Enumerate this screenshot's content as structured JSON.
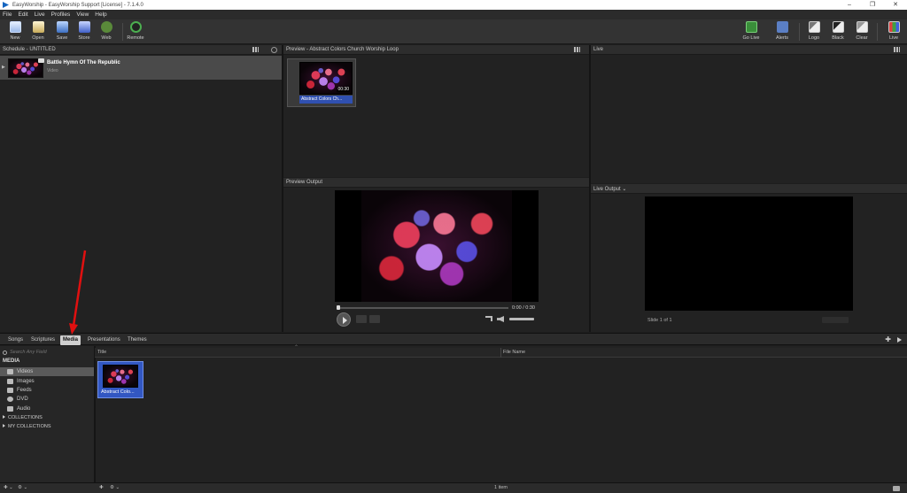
{
  "window": {
    "title": "EasyWorship - EasyWorship Support [License] - 7.1.4.0",
    "controls": [
      "–",
      "❐",
      "✕"
    ]
  },
  "menu": [
    "File",
    "Edit",
    "Live",
    "Profiles",
    "View",
    "Help"
  ],
  "toolbar": {
    "new": "New",
    "open": "Open",
    "save": "Save",
    "store": "Store",
    "web": "Web",
    "remote": "Remote",
    "go_live": "Go Live",
    "alerts": "Alerts",
    "logo": "Logo",
    "black": "Black",
    "clear": "Clear",
    "live": "Live"
  },
  "schedule": {
    "header": "Schedule - UNTITLED",
    "items": [
      {
        "title": "Battle Hymn Of The Republic",
        "subtitle": "Video"
      }
    ]
  },
  "preview": {
    "header": "Preview - Abstract Colors Church Worship Loop",
    "slides": [
      {
        "number": "1",
        "duration": "00:30",
        "caption": "Abstract Colors Ch..."
      }
    ]
  },
  "preview_output": {
    "header": "Preview Output",
    "time": "0:00 / 0:30",
    "progress": 0.0
  },
  "live": {
    "header": "Live",
    "output_header": "Live Output ⌄",
    "slide_count": "Slide 1 of 1"
  },
  "library": {
    "tabs": [
      "Songs",
      "Scriptures",
      "Media",
      "Presentations",
      "Themes"
    ],
    "active_tab": "Media",
    "search_placeholder": "Search Any Field",
    "section": "MEDIA",
    "tree": [
      "Videos",
      "Images",
      "Feeds",
      "DVD",
      "Audio"
    ],
    "selected_tree_item": "Videos",
    "groups": [
      "COLLECTIONS",
      "MY COLLECTIONS"
    ],
    "columns": [
      "Title",
      "File Name"
    ],
    "items": [
      {
        "caption": "Abstract Colo..."
      }
    ]
  },
  "status": {
    "count": "1 item"
  },
  "colors": {
    "accent": "#3257c2",
    "annotation_arrow": "#e01010"
  }
}
